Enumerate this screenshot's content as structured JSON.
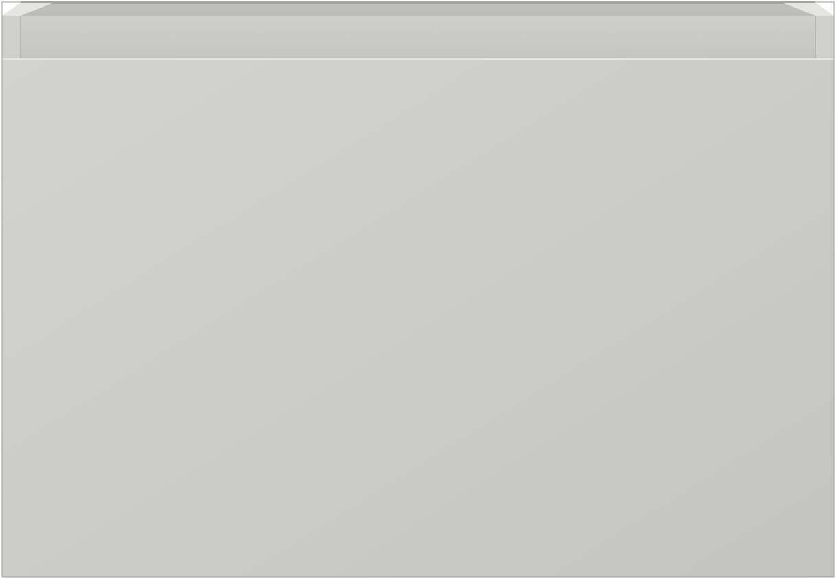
{
  "object": {
    "kind": "product-render",
    "subject": "cabinet-drawer-unit",
    "colors": {
      "front_light": "#d3d3d1",
      "front_dark": "#c4c4c2",
      "top_rim": "#cfcfcd",
      "inner_wall": "#bdbdbb",
      "inner_shadow": "#a9a9a7",
      "edge_highlight": "#e4e4e2",
      "outline": "#9d9d9b",
      "background": "#ffffff"
    }
  }
}
